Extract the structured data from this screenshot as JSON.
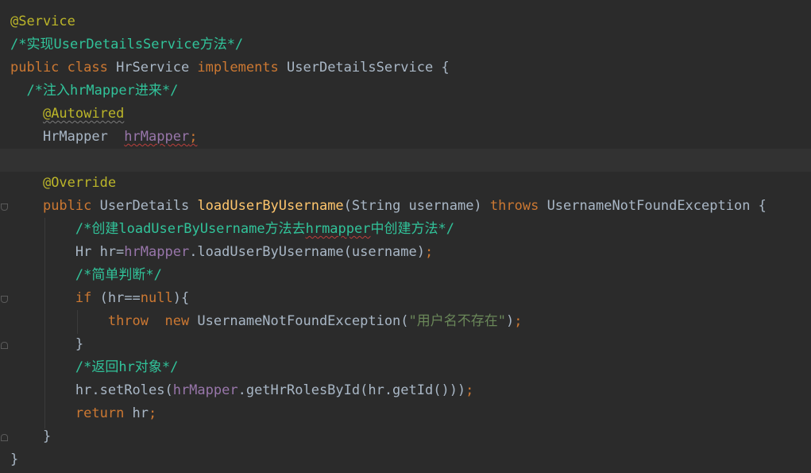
{
  "editor": {
    "lines": [
      [
        [
          "ann",
          "@Service"
        ]
      ],
      [
        [
          "cmt",
          "/*实现UserDetailsService方法*/"
        ]
      ],
      [
        [
          "kw",
          "public class "
        ],
        [
          "plain",
          "HrService "
        ],
        [
          "kw",
          "implements "
        ],
        [
          "plain",
          "UserDetailsService {"
        ]
      ],
      [
        [
          "plain",
          "  "
        ],
        [
          "cmt",
          "/*注入hrMapper进来*/"
        ]
      ],
      [
        [
          "plain",
          "    "
        ],
        [
          "ann-sq",
          "@Autowired"
        ]
      ],
      [
        [
          "plain",
          "    HrMapper  "
        ],
        [
          "fld-sq",
          "hrMapper"
        ],
        [
          "kw-sq",
          ";"
        ]
      ],
      [],
      [
        [
          "plain",
          "    "
        ],
        [
          "ann",
          "@Override"
        ]
      ],
      [
        [
          "plain",
          "    "
        ],
        [
          "kw",
          "public "
        ],
        [
          "plain",
          "UserDetails "
        ],
        [
          "mth",
          "loadUserByUsername"
        ],
        [
          "plain",
          "(String username) "
        ],
        [
          "kw",
          "throws "
        ],
        [
          "plain",
          "UsernameNotFoundException {"
        ]
      ],
      [
        [
          "plain",
          "        "
        ],
        [
          "cmt",
          "/*创建loadUserByUsername方法去"
        ],
        [
          "cmt-sq",
          "hrmapper"
        ],
        [
          "cmt",
          "中创建方法*/"
        ]
      ],
      [
        [
          "plain",
          "        Hr hr="
        ],
        [
          "fld",
          "hrMapper"
        ],
        [
          "plain",
          ".loadUserByUsername(username)"
        ],
        [
          "kw",
          ";"
        ]
      ],
      [
        [
          "plain",
          "        "
        ],
        [
          "cmt",
          "/*简单判断*/"
        ]
      ],
      [
        [
          "plain",
          "        "
        ],
        [
          "kw",
          "if "
        ],
        [
          "plain",
          "(hr=="
        ],
        [
          "kw",
          "null"
        ],
        [
          "plain",
          "){"
        ]
      ],
      [
        [
          "plain",
          "            "
        ],
        [
          "kw",
          "throw  new "
        ],
        [
          "plain",
          "UsernameNotFoundException("
        ],
        [
          "str",
          "\"用户名不存在\""
        ],
        [
          "plain",
          ")"
        ],
        [
          "kw",
          ";"
        ]
      ],
      [
        [
          "plain",
          "        }"
        ]
      ],
      [
        [
          "plain",
          "        "
        ],
        [
          "cmt",
          "/*返回hr对象*/"
        ]
      ],
      [
        [
          "plain",
          "        hr.setRoles("
        ],
        [
          "fld",
          "hrMapper"
        ],
        [
          "plain",
          ".getHrRolesById(hr.getId()))"
        ],
        [
          "kw",
          ";"
        ]
      ],
      [
        [
          "plain",
          "        "
        ],
        [
          "kw",
          "return "
        ],
        [
          "plain",
          "hr"
        ],
        [
          "kw",
          ";"
        ]
      ],
      [
        [
          "plain",
          "    }"
        ]
      ],
      [
        [
          "plain",
          "}"
        ]
      ]
    ],
    "current_line": 6
  }
}
